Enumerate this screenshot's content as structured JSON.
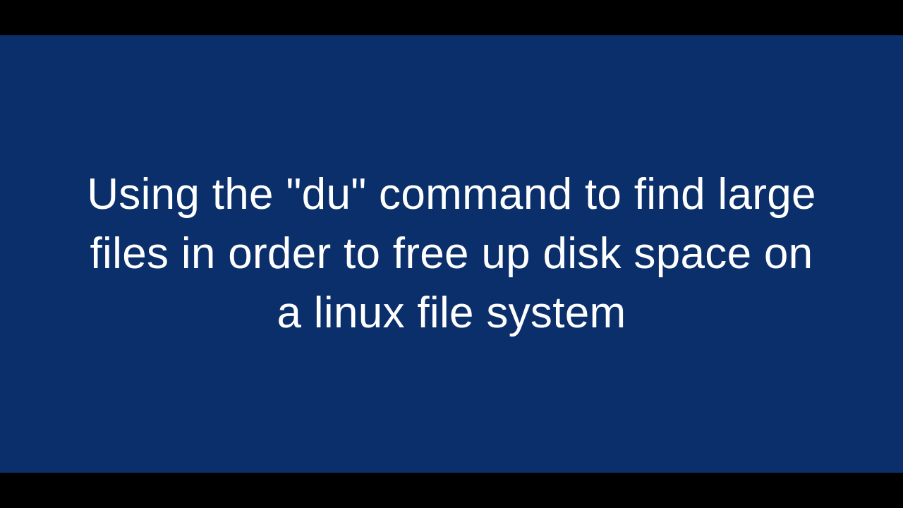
{
  "slide": {
    "title": "Using the \"du\" command to find large files in order to free up disk space on a linux file system"
  },
  "colors": {
    "background_letterbox": "#000000",
    "slide_background": "#0a2f6b",
    "text": "#ffffff"
  }
}
